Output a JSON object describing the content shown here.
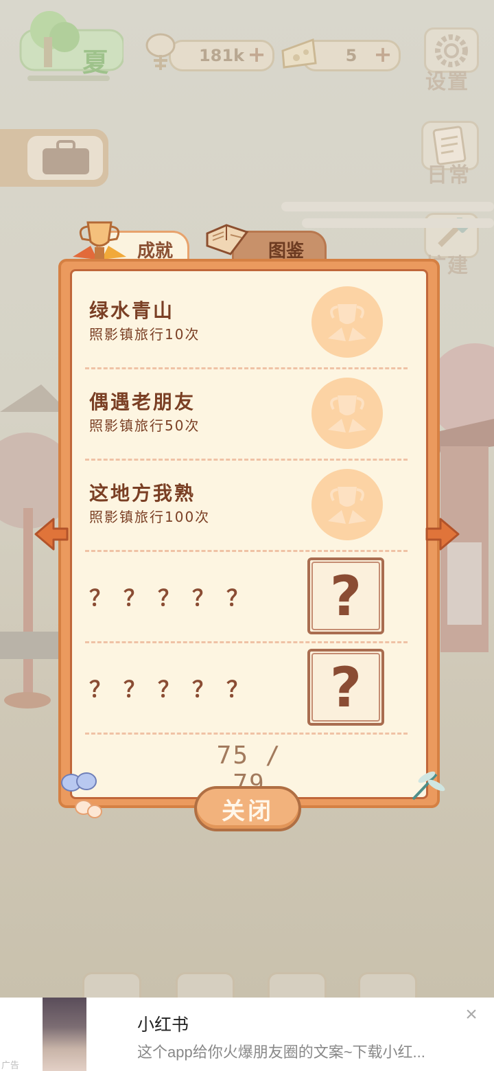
{
  "hud": {
    "season": "夏",
    "fish_count": "181k",
    "cheese_count": "5",
    "settings_label": "设置",
    "daily_label": "日常",
    "build_label": "扩建"
  },
  "tabs": [
    {
      "label": "成就",
      "active": true
    },
    {
      "label": "图鉴",
      "active": false
    }
  ],
  "achievements": [
    {
      "title": "绿水青山",
      "subtitle": "照影镇旅行10次",
      "unlocked": true
    },
    {
      "title": "偶遇老朋友",
      "subtitle": "照影镇旅行50次",
      "unlocked": true
    },
    {
      "title": "这地方我熟",
      "subtitle": "照影镇旅行100次",
      "unlocked": true
    },
    {
      "title": "？？？？？",
      "unlocked": false
    },
    {
      "title": "？？？？？",
      "unlocked": false
    }
  ],
  "mystery_glyph": "?",
  "progress": "75 / 79",
  "close_label": "关闭",
  "ad": {
    "title": "小红书",
    "description": "这个app给你火爆朋友圈的文案~下载小红...",
    "tag": "广告",
    "close": "×"
  },
  "colors": {
    "panel_frame": "#eb9a5e",
    "panel_inner": "#fdf5e1",
    "text_brown": "#7a3f24",
    "medal": "#fcd3a4"
  }
}
